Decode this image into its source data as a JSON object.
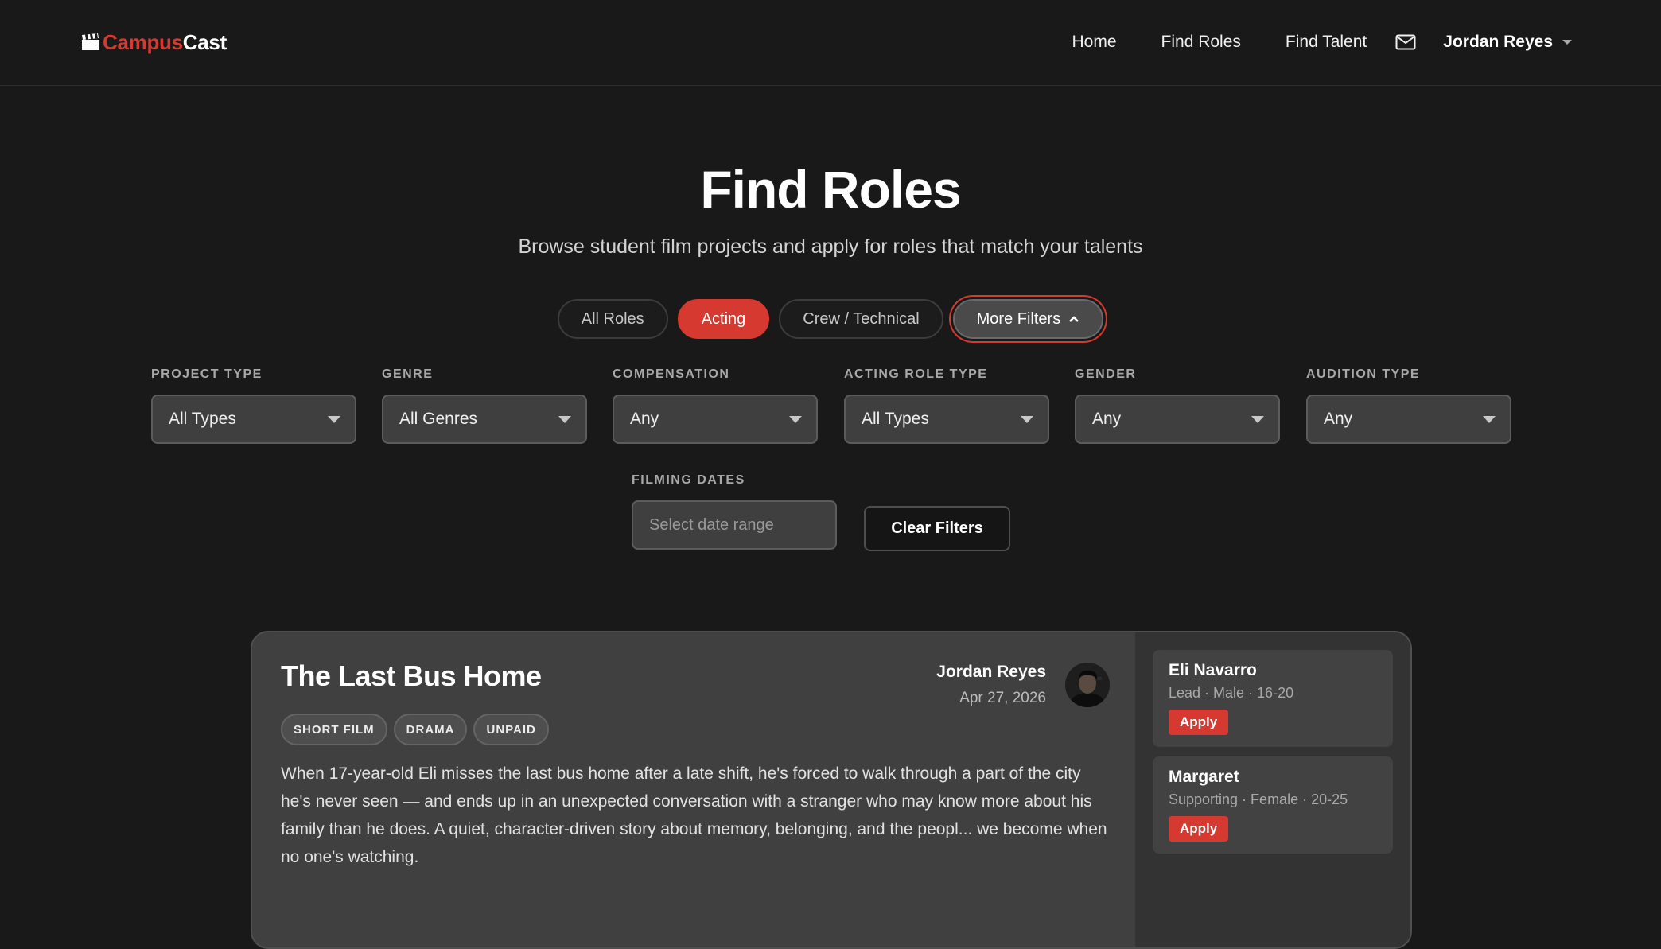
{
  "brand": {
    "part1": "Campus",
    "part2": "Cast",
    "icon": "clapperboard-icon",
    "accent_color": "#d6392f"
  },
  "nav": {
    "links": [
      "Home",
      "Find Roles",
      "Find Talent"
    ],
    "mail_icon": "mail-icon",
    "user_name": "Jordan Reyes"
  },
  "hero": {
    "title": "Find Roles",
    "subtitle": "Browse student film projects and apply for roles that match your talents"
  },
  "pills": {
    "all": "All Roles",
    "acting": "Acting",
    "crew": "Crew / Technical",
    "more": "More Filters",
    "selected": "Acting"
  },
  "filters": [
    {
      "label": "PROJECT TYPE",
      "value": "All Types"
    },
    {
      "label": "GENRE",
      "value": "All Genres"
    },
    {
      "label": "COMPENSATION",
      "value": "Any"
    },
    {
      "label": "ACTING ROLE TYPE",
      "value": "All Types"
    },
    {
      "label": "GENDER",
      "value": "Any"
    },
    {
      "label": "AUDITION TYPE",
      "value": "Any"
    }
  ],
  "dates": {
    "label": "FILMING DATES",
    "placeholder": "Select date range"
  },
  "clear_label": "Clear Filters",
  "project": {
    "title": "The Last Bus Home",
    "tags": [
      "SHORT FILM",
      "DRAMA",
      "UNPAID"
    ],
    "poster_name": "Jordan Reyes",
    "date": "Apr 27, 2026",
    "description": "When 17-year-old Eli misses the last bus home after a late shift, he's forced to walk through a part of the city he's never seen — and ends up in an unexpected conversation with a stranger who may know more about his family than he does. A quiet, character-driven story about memory, belonging, and the peopl... we become when no one's watching.",
    "roles": [
      {
        "name": "Eli Navarro",
        "meta": "Lead · Male · 16-20",
        "apply": "Apply"
      },
      {
        "name": "Margaret",
        "meta": "Supporting · Female · 20-25",
        "apply": "Apply"
      }
    ]
  }
}
